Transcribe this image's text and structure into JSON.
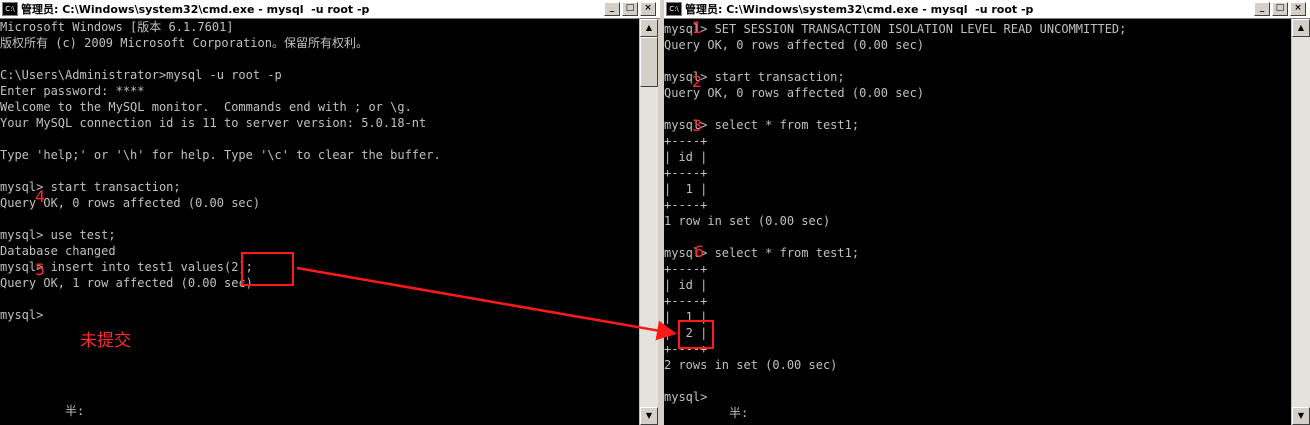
{
  "left_window": {
    "title": "管理员: C:\\Windows\\system32\\cmd.exe - mysql  -u root -p",
    "icon_text": "C:\\",
    "buttons": {
      "minimize": "_",
      "maximize": "□",
      "close": "×"
    },
    "lines": [
      "Microsoft Windows [版本 6.1.7601]",
      "版权所有 (c) 2009 Microsoft Corporation。保留所有权利。",
      "",
      "C:\\Users\\Administrator>mysql -u root -p",
      "Enter password: ****",
      "Welcome to the MySQL monitor.  Commands end with ; or \\g.",
      "Your MySQL connection id is 11 to server version: 5.0.18-nt",
      "",
      "Type 'help;' or '\\h' for help. Type '\\c' to clear the buffer.",
      "",
      "mysql> start transaction;",
      "Query OK, 0 rows affected (0.00 sec)",
      "",
      "mysql> use test;",
      "Database changed",
      "mysql> insert into test1 values(2);",
      "Query OK, 1 row affected (0.00 sec)",
      "",
      "mysql>",
      "",
      "",
      "",
      "",
      "",
      "",
      "         半:"
    ]
  },
  "right_window": {
    "title": "管理员: C:\\Windows\\system32\\cmd.exe - mysql  -u root -p",
    "icon_text": "C:\\",
    "buttons": {
      "minimize": "_",
      "maximize": "□",
      "close": "×"
    },
    "lines": [
      "mysql> SET SESSION TRANSACTION ISOLATION LEVEL READ UNCOMMITTED;",
      "Query OK, 0 rows affected (0.00 sec)",
      "",
      "mysql> start transaction;",
      "Query OK, 0 rows affected (0.00 sec)",
      "",
      "mysql> select * from test1;",
      "+----+",
      "| id |",
      "+----+",
      "|  1 |",
      "+----+",
      "1 row in set (0.00 sec)",
      "",
      "mysql> select * from test1;",
      "+----+",
      "| id |",
      "+----+",
      "|  1 |",
      "|  2 |",
      "+----+",
      "2 rows in set (0.00 sec)",
      "",
      "mysql>",
      "         半:"
    ]
  },
  "annotations": {
    "step_1": "1",
    "step_2": "2",
    "step_3": "3",
    "step_4": "4",
    "step_5": "5",
    "step_6": "6",
    "uncommitted_note": "未提交",
    "color": "#ff1a1a"
  },
  "scrollbar": {
    "up": "▲",
    "down": "▼"
  }
}
